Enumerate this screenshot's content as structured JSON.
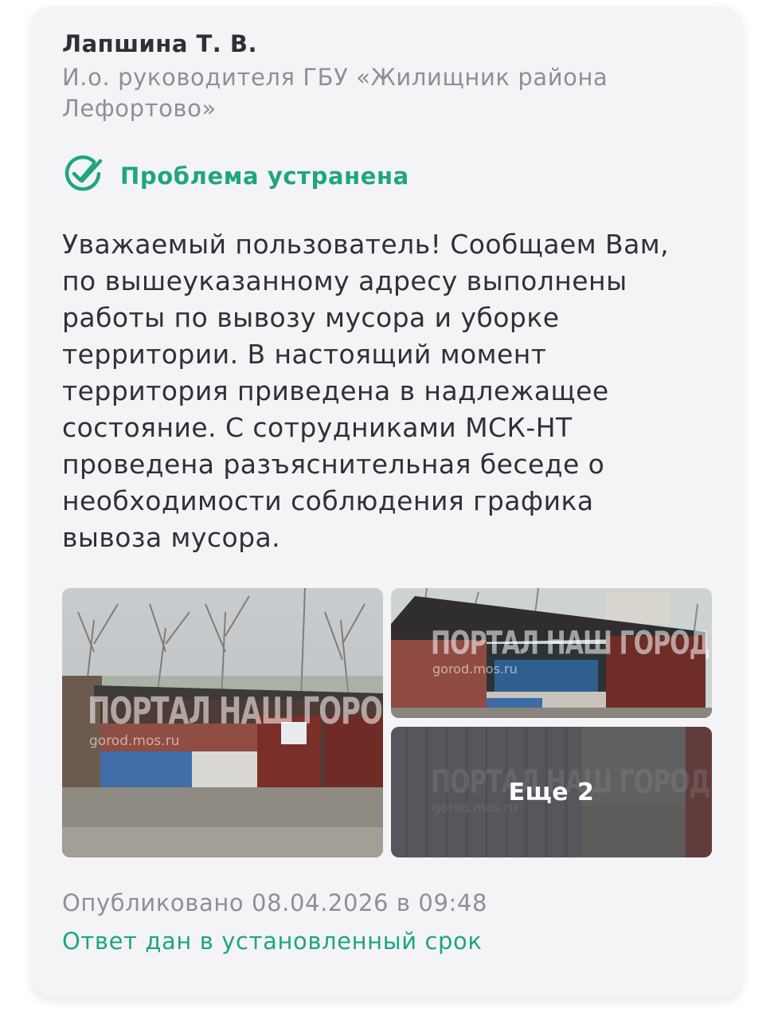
{
  "author": {
    "name": "Лапшина Т. В.",
    "role": "И.о. руководителя ГБУ «Жилищник района Лефортово»"
  },
  "status": {
    "icon": "double-check-icon",
    "label": "Проблема устранена",
    "color": "#1fa582"
  },
  "message": "Уважаемый пользователь! Сообщаем Вам,\nпо вышеуказанному адресу выполнены\nработы по вывозу мусора и уборке\nтерритории. В настоящий момент\nтерритория приведена в надлежащее\nсостояние. С сотрудниками МСК-НТ\nпроведена разъяснительная беседе о\nнеобходимости соблюдения графика\nвывоза мусора.",
  "photos": {
    "watermark": "ПОРТАЛ НАШ ГОРОД",
    "watermark_url": "gorod.mos.ru",
    "more_label": "Еще 2"
  },
  "footer": {
    "published": "Опубликовано 08.04.2026 в 09:48",
    "deadline": "Ответ дан в установленный срок"
  }
}
